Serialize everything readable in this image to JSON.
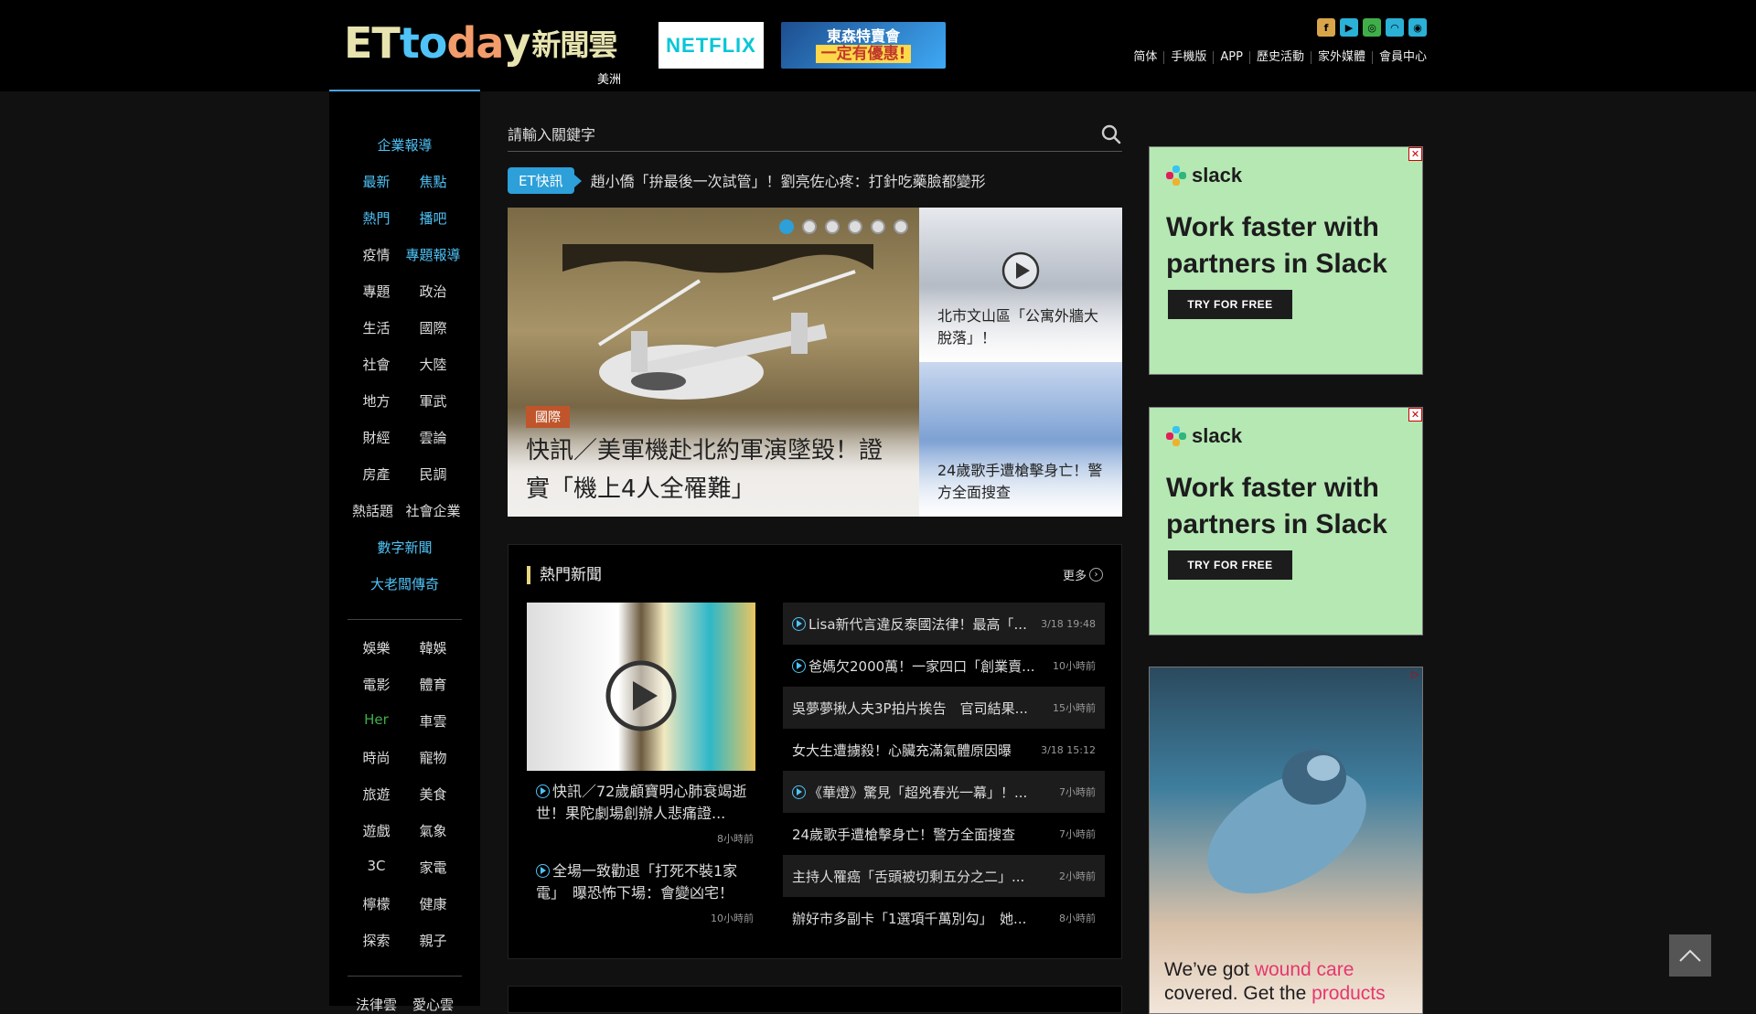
{
  "header": {
    "logo_parts": [
      "ET",
      "to",
      "da",
      "y",
      "新聞雲"
    ],
    "region": "美洲",
    "netflix_label": "NETFLIX",
    "promo_line1": "東森特賣會",
    "promo_line2": "一定有優惠!",
    "social_icons": [
      "facebook-icon",
      "youtube-icon",
      "instagram-icon",
      "rss-icon",
      "weibo-icon"
    ],
    "nav": [
      "简体",
      "手機版",
      "APP",
      "歷史活動",
      "家外媒體",
      "會員中心"
    ]
  },
  "sidebar": {
    "top": "企業報導",
    "rows": [
      [
        "最新",
        "焦點"
      ],
      [
        "熱門",
        "播吧"
      ],
      [
        "疫情",
        "專題報導"
      ],
      [
        "專題",
        "政治"
      ],
      [
        "生活",
        "國際"
      ],
      [
        "社會",
        "大陸"
      ],
      [
        "地方",
        "軍武"
      ],
      [
        "財經",
        "雲論"
      ],
      [
        "房產",
        "民調"
      ],
      [
        "熱話題",
        "社會企業"
      ]
    ],
    "single1": "數字新聞",
    "single2": "大老闆傳奇",
    "rows2": [
      [
        "娛樂",
        "韓娛"
      ],
      [
        "電影",
        "體育"
      ],
      [
        "Her",
        "車雲"
      ],
      [
        "時尚",
        "寵物"
      ],
      [
        "旅遊",
        "美食"
      ],
      [
        "遊戲",
        "氣象"
      ],
      [
        "3C",
        "家電"
      ],
      [
        "檸檬",
        "健康"
      ],
      [
        "探索",
        "親子"
      ]
    ],
    "bottom_row": [
      "法律雲",
      "愛心雲"
    ]
  },
  "search": {
    "placeholder": "請輸入關鍵字"
  },
  "flash": {
    "badge": "ET快訊",
    "text": "趙小僑「拚最後一次試管」！劉亮佐心疼：打針吃藥臉都變形"
  },
  "hero": {
    "category": "國際",
    "title": "快訊／美軍機赴北約軍演墜毀！證實「機上4人全罹難」",
    "slide_count": 6,
    "active_slide": 1,
    "side1": "北市文山區「公寓外牆大脫落」！",
    "side2": "24歲歌手遭槍擊身亡！警方全面搜查"
  },
  "hot": {
    "title": "熱門新聞",
    "more": "更多",
    "left_items": [
      {
        "text": "快訊／72歲顧寶明心肺衰竭逝世！果陀劇場創辦人悲痛證...",
        "time": "8小時前"
      },
      {
        "text": "全場一致勸退「打死不裝1家電」　曝恐怖下場：會變凶宅！",
        "time": "10小時前"
      }
    ],
    "list": [
      {
        "text": "Lisa新代言違反泰國法律！最高「...",
        "time": "3/18 19:48",
        "video": true
      },
      {
        "text": "爸媽欠2000萬！一家四口「創業賣...",
        "time": "10小時前",
        "video": true
      },
      {
        "text": "吳夢夢揪人夫3P拍片挨告　官司結果...",
        "time": "15小時前",
        "video": false
      },
      {
        "text": "女大生遭擄殺！心臟充滿氣體原因曝",
        "time": "3/18 15:12",
        "video": false
      },
      {
        "text": "《華燈》驚見「超兇春光一幕」！...",
        "time": "7小時前",
        "video": true
      },
      {
        "text": "24歲歌手遭槍擊身亡！警方全面搜查",
        "time": "7小時前",
        "video": false
      },
      {
        "text": "主持人罹癌「舌頭被切剩五分之二」...",
        "time": "2小時前",
        "video": false
      },
      {
        "text": "辦好市多副卡「1選項千萬別勾」　她...",
        "time": "8小時前",
        "video": false
      }
    ]
  },
  "ads": {
    "brand": "slack",
    "headline": "Work faster with partners in Slack",
    "cta": "TRY FOR FREE",
    "ad3_pre": "We’ve got ",
    "ad3_hl1": "wound care",
    "ad3_mid": " covered. Get the ",
    "ad3_hl2": "products"
  },
  "colors": {
    "accent_blue": "#4fc3f7",
    "badge_blue": "#2d9fd9",
    "her_green": "#3fae49",
    "tag_orange": "#c0552b"
  }
}
